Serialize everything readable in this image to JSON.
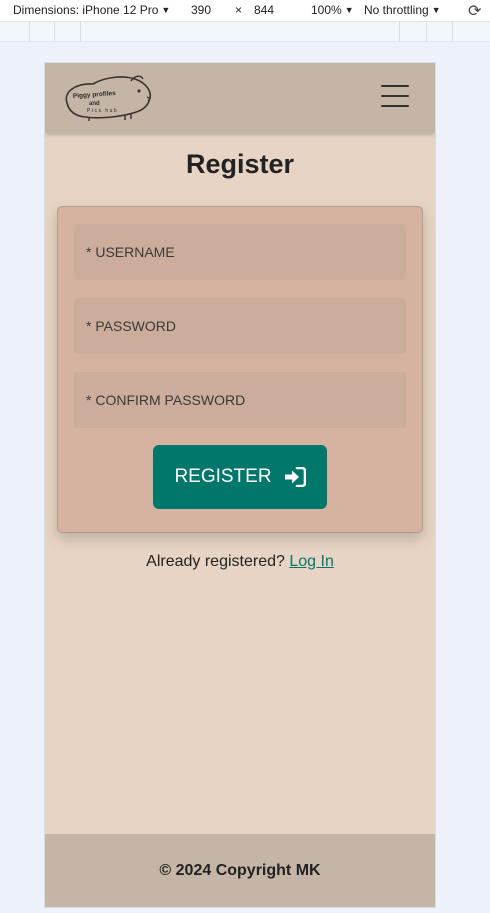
{
  "devtools": {
    "dimensions_label": "Dimensions: iPhone 12 Pro",
    "width": "390",
    "times": "×",
    "height": "844",
    "zoom": "100%",
    "throttling": "No throttling",
    "caret": "▼",
    "rotate_icon": "rotate-icon"
  },
  "navbar": {
    "logo_text_line1": "Piggy profiles",
    "logo_text_line2": "and",
    "logo_text_line3": "Pics hub",
    "menu_icon": "hamburger-icon"
  },
  "page": {
    "title": "Register"
  },
  "form": {
    "username_placeholder": "* USERNAME",
    "password_placeholder": "* PASSWORD",
    "confirm_placeholder": "* CONFIRM PASSWORD",
    "register_label": "REGISTER",
    "register_icon": "sign-in-icon"
  },
  "login": {
    "prompt": "Already registered?",
    "link": "Log In"
  },
  "footer": {
    "copyright": "© 2024 Copyright MK"
  },
  "colors": {
    "navbar": "#c5b5a6",
    "background": "#e7d4c4",
    "card": "#d6b3a0",
    "accent": "#00776b"
  }
}
